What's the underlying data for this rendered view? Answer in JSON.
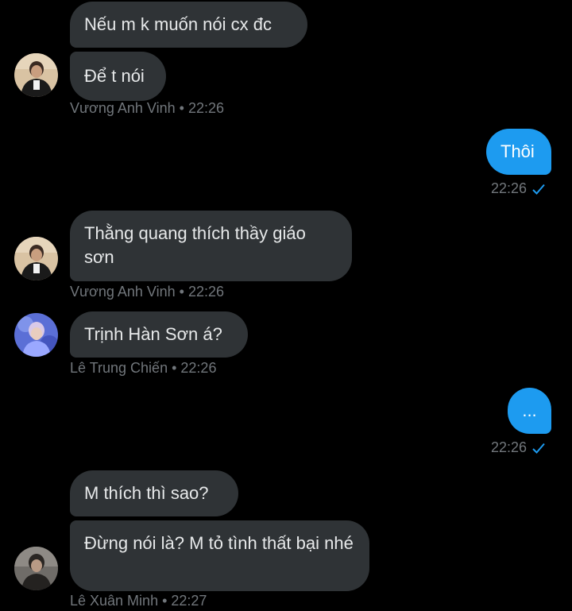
{
  "messages": {
    "m1": {
      "text": "Nếu m k muốn nói cx đc"
    },
    "m2": {
      "text": "Để t nói"
    },
    "meta1": {
      "sender": "Vương Anh Vinh",
      "time": "22:26"
    },
    "m3": {
      "text": "Thôi"
    },
    "meta3": {
      "time": "22:26"
    },
    "m4": {
      "text": "Thằng quang thích thầy giáo sơn"
    },
    "meta4": {
      "sender": "Vương Anh Vinh",
      "time": "22:26"
    },
    "m5": {
      "text": "Trịnh Hàn Sơn á?"
    },
    "meta5": {
      "sender": "Lê Trung Chiến",
      "time": "22:26"
    },
    "m6": {
      "text": "..."
    },
    "meta6": {
      "time": "22:26"
    },
    "m7": {
      "text": "M thích thì sao?"
    },
    "m8": {
      "text": "Đừng nói là? M tỏ tình thất bại nhé"
    },
    "meta8": {
      "sender": "Lê Xuân Minh",
      "time": "22:27"
    }
  },
  "separator": "•",
  "colors": {
    "background": "#000000",
    "incoming_bubble": "#2f3336",
    "outgoing_bubble": "#1d9bf0",
    "meta_text": "#71767b",
    "read_check": "#1d9bf0"
  },
  "icons": {
    "read_receipt": "check-icon"
  }
}
